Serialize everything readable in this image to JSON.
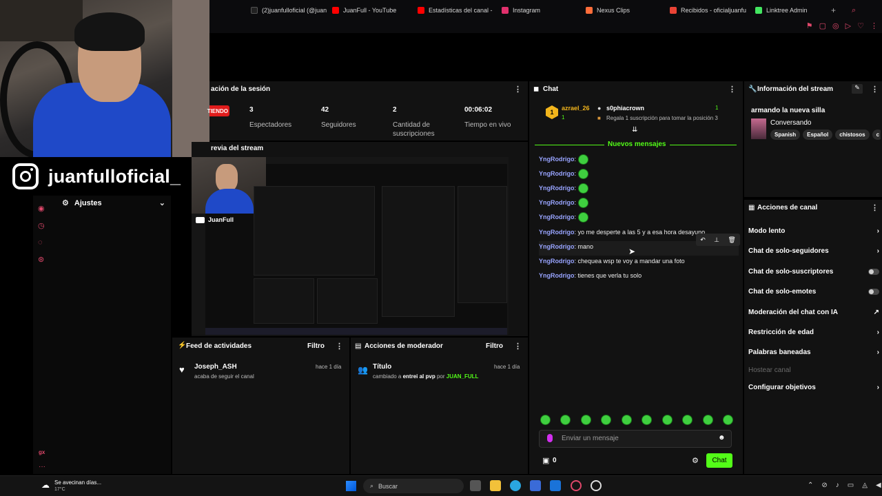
{
  "browser": {
    "tabs": [
      {
        "label": "(2)juanfulloficial (@juan",
        "color": "#111111",
        "icon": "tiktok-icon"
      },
      {
        "label": "JuanFull - YouTube",
        "color": "#ff0000",
        "icon": "youtube-icon"
      },
      {
        "label": "Estadísticas del canal -",
        "color": "#ff0000",
        "icon": "youtube-studio-icon"
      },
      {
        "label": "Instagram",
        "color": "#e1306c",
        "icon": "instagram-icon"
      },
      {
        "label": "Nexus Clips",
        "color": "#ff6d3a",
        "icon": "nexus-icon"
      },
      {
        "label": "Recibidos - oficialjuanfu",
        "color": "#ea4335",
        "icon": "gmail-icon"
      },
      {
        "label": "Linktree Admin",
        "color": "#43e660",
        "icon": "linktree-icon"
      }
    ]
  },
  "overlay": {
    "instagram_handle": "juanfulloficial_"
  },
  "sidebar": {
    "settings_label": "Ajustes",
    "bottom_text": "gx"
  },
  "session": {
    "title": "ación de la sesión",
    "live_label": "TIENDO",
    "stats": [
      {
        "value": "3",
        "label": "Espectadores"
      },
      {
        "value": "42",
        "label": "Seguidores"
      },
      {
        "value": "2",
        "label": "Cantidad de suscripciones"
      },
      {
        "value": "00:06:02",
        "label": "Tiempo en vivo"
      }
    ]
  },
  "preview": {
    "title": "revia del stream",
    "channel_label": "JuanFull"
  },
  "feed": {
    "title": "Feed de actividades",
    "filter_label": "Filtro",
    "items": [
      {
        "user": "Joseph_ASH",
        "text": "acaba de seguir el canal",
        "time": "hace 1 día"
      }
    ]
  },
  "mod_actions": {
    "title": "Acciones de moderador",
    "filter_label": "Filtro",
    "items": [
      {
        "label": "Título",
        "time": "hace 1 día",
        "text_prefix": "cambiado a",
        "text_value": "entrei al pvp",
        "text_by": "por",
        "text_user": "JUAN_FULL"
      }
    ]
  },
  "chat": {
    "title": "Chat",
    "pinned": {
      "rank": "1",
      "user1": "azrael_26",
      "user1_count": "1",
      "user2": "s0phiacrown",
      "user2_count": "1",
      "gift_text": "Regala 1 suscripción para tomar la posición 3"
    },
    "new_messages_label": "Nuevos mensajes",
    "messages": [
      {
        "user": "YngRodrigo",
        "text": "",
        "emote": true
      },
      {
        "user": "YngRodrigo",
        "text": "",
        "emote": true
      },
      {
        "user": "YngRodrigo",
        "text": "",
        "emote": true
      },
      {
        "user": "YngRodrigo",
        "text": "",
        "emote": true
      },
      {
        "user": "YngRodrigo",
        "text": "",
        "emote": true
      },
      {
        "user": "YngRodrigo",
        "text": "yo me desperte a las 5 y a esa hora desayuno",
        "emote": false
      },
      {
        "user": "YngRodrigo",
        "text": "mano",
        "emote": false
      },
      {
        "user": "YngRodrigo",
        "text": "chequea wsp te voy a mandar una foto",
        "emote": false
      },
      {
        "user": "YngRodrigo",
        "text": "tienes que verla tu solo",
        "emote": false
      }
    ],
    "input_placeholder": "Enviar un mensaje",
    "points": "0",
    "send_label": "Chat"
  },
  "stream_info": {
    "title": "Información del stream",
    "stream_title": "armando la nueva silla",
    "category": "Conversando",
    "tags": [
      "Spanish",
      "Español",
      "chistosos",
      "c"
    ]
  },
  "channel_actions": {
    "title": "Acciones de canal",
    "items": [
      {
        "label": "Modo lento",
        "control": "chevron"
      },
      {
        "label": "Chat de solo-seguidores",
        "control": "chevron"
      },
      {
        "label": "Chat de solo-suscriptores",
        "control": "toggle"
      },
      {
        "label": "Chat de solo-emotes",
        "control": "toggle"
      },
      {
        "label": "Moderación del chat con IA",
        "control": "external"
      },
      {
        "label": "Restricción de edad",
        "control": "chevron"
      },
      {
        "label": "Palabras baneadas",
        "control": "chevron"
      },
      {
        "label": "Hostear canal",
        "control": "none",
        "disabled": true
      },
      {
        "label": "Configurar objetivos",
        "control": "chevron"
      }
    ]
  },
  "taskbar": {
    "weather_title": "Se avecinan días...",
    "weather_temp": "17°C",
    "search_label": "Buscar"
  },
  "colors": {
    "accent_green": "#53fc18",
    "panel": "#121212",
    "live_red": "#e01c1c",
    "chat_user": "#98a4ff"
  }
}
